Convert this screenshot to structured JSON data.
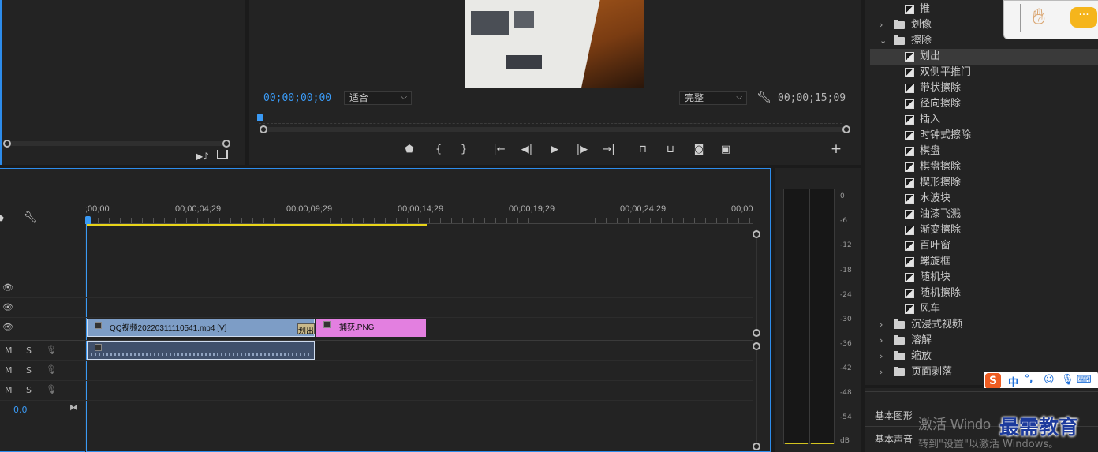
{
  "program": {
    "timecode_in": "00;00;00;00",
    "fit_label": "适合",
    "quality_label": "完整",
    "timecode_duration": "00;00;15;09"
  },
  "timeline": {
    "ruler_labels": [
      ";00;00",
      "00;00;04;29",
      "00;00;09;29",
      "00;00;14;29",
      "00;00;19;29",
      "00;00;24;29",
      "00;00"
    ],
    "audio_level": "0.0",
    "mute_label": "M",
    "solo_label": "S",
    "clips": {
      "video_clip": "QQ视频20220311110541.mp4 [V]",
      "transition_label": "划出",
      "png_clip": "捕获.PNG"
    }
  },
  "meter": {
    "db_labels": [
      "0",
      "-6",
      "-12",
      "-18",
      "-24",
      "-30",
      "-36",
      "-42",
      "-48",
      "-54",
      "dB"
    ]
  },
  "effects": {
    "items": [
      {
        "type": "effect",
        "label": "推",
        "indent": 1
      },
      {
        "type": "folder",
        "label": "划像",
        "indent": 0,
        "open": false
      },
      {
        "type": "folder",
        "label": "擦除",
        "indent": 0,
        "open": true
      },
      {
        "type": "effect",
        "label": "划出",
        "indent": 1,
        "selected": true
      },
      {
        "type": "effect",
        "label": "双侧平推门",
        "indent": 1
      },
      {
        "type": "effect",
        "label": "带状擦除",
        "indent": 1
      },
      {
        "type": "effect",
        "label": "径向擦除",
        "indent": 1
      },
      {
        "type": "effect",
        "label": "插入",
        "indent": 1
      },
      {
        "type": "effect",
        "label": "时钟式擦除",
        "indent": 1
      },
      {
        "type": "effect",
        "label": "棋盘",
        "indent": 1
      },
      {
        "type": "effect",
        "label": "棋盘擦除",
        "indent": 1
      },
      {
        "type": "effect",
        "label": "楔形擦除",
        "indent": 1
      },
      {
        "type": "effect",
        "label": "水波块",
        "indent": 1
      },
      {
        "type": "effect",
        "label": "油漆飞溅",
        "indent": 1
      },
      {
        "type": "effect",
        "label": "渐变擦除",
        "indent": 1
      },
      {
        "type": "effect",
        "label": "百叶窗",
        "indent": 1
      },
      {
        "type": "effect",
        "label": "螺旋框",
        "indent": 1
      },
      {
        "type": "effect",
        "label": "随机块",
        "indent": 1
      },
      {
        "type": "effect",
        "label": "随机擦除",
        "indent": 1
      },
      {
        "type": "effect",
        "label": "风车",
        "indent": 1
      },
      {
        "type": "folder",
        "label": "沉浸式视频",
        "indent": 0,
        "open": false
      },
      {
        "type": "folder",
        "label": "溶解",
        "indent": 0,
        "open": false
      },
      {
        "type": "folder",
        "label": "缩放",
        "indent": 0,
        "open": false
      },
      {
        "type": "folder",
        "label": "页面剥落",
        "indent": 0,
        "open": false
      }
    ]
  },
  "lower_panels": {
    "basic_graphics": "基本图形",
    "basic_sound": "基本声音"
  },
  "ime": {
    "mode": "中",
    "punct": "°,"
  },
  "watermark": {
    "activate_line1": "激活 Windo",
    "activate_line2": "转到\"设置\"以激活 Windows。",
    "brand": "最需教育"
  },
  "colors": {
    "accent_blue": "#2d8ceb",
    "video_clip": "#7d9dc6",
    "png_clip": "#e37fe0",
    "work_area": "#e8d419"
  }
}
